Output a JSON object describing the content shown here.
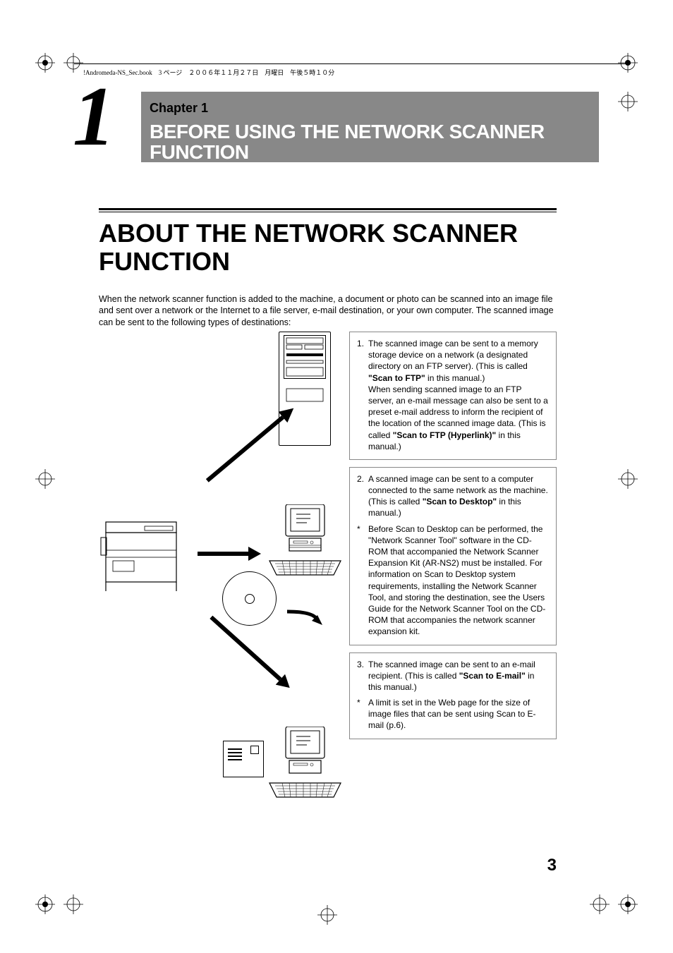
{
  "crop_header": "!Andromeda-NS_Sec.book　3 ページ　２００６年１１月２７日　月曜日　午後５時１０分",
  "chapter": {
    "label": "Chapter 1",
    "title": "BEFORE USING THE NETWORK SCANNER FUNCTION",
    "number": "1"
  },
  "section_title": "ABOUT THE NETWORK SCANNER FUNCTION",
  "intro": "When the network scanner function is added to the machine, a document or photo can be scanned into an image file and sent over a network or the Internet to a file server, e-mail destination, or your own computer. The scanned image can be sent to the following types of destinations:",
  "boxes": [
    {
      "items": [
        {
          "num": "1.",
          "pre": "The scanned image can be sent to a memory storage device on a network (a designated directory on an FTP server). (This is called ",
          "bold": "\"Scan to FTP\"",
          "mid": " in this manual.)\nWhen sending scanned image to an FTP server, an e-mail message can also be sent to a preset e-mail address to inform the recipient of the location of the scanned image data. (This is called ",
          "bold2": "\"Scan to FTP (Hyperlink)\"",
          "post": " in this manual.)"
        }
      ]
    },
    {
      "items": [
        {
          "num": "2.",
          "pre": "A scanned image can be sent to a computer connected to the same network as the machine. (This is called ",
          "bold": "\"Scan to Desktop\"",
          "post": " in this manual.)"
        },
        {
          "num": "*",
          "pre": "Before Scan to Desktop can be performed, the \"Network Scanner Tool\" software in the CD-ROM that accompanied the Network Scanner Expansion Kit (AR-NS2) must be installed. For information on Scan to Desktop system requirements, installing the Network Scanner Tool, and storing the destination, see the Users Guide for the Network Scanner Tool on the CD-ROM that accompanies the network scanner expansion kit."
        }
      ]
    },
    {
      "items": [
        {
          "num": "3.",
          "pre": "The scanned image can be sent to an e-mail recipient. (This is called ",
          "bold": "\"Scan to E-mail\"",
          "post": " in this manual.)"
        },
        {
          "num": "*",
          "pre": "A limit is set in the Web page for the size of image files that can be sent using Scan to E-mail (p.6)."
        }
      ]
    }
  ],
  "page_number": "3"
}
